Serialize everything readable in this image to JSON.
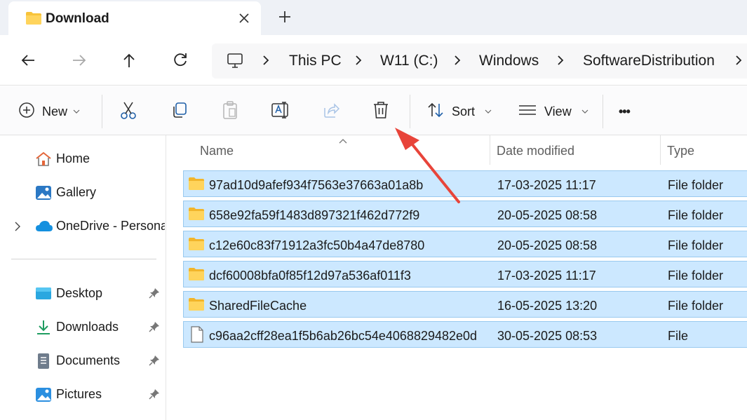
{
  "window": {
    "tab_title": "Download",
    "new_tab_symbol": "+"
  },
  "breadcrumb": [
    {
      "label": "This PC"
    },
    {
      "label": "W11 (C:)"
    },
    {
      "label": "Windows"
    },
    {
      "label": "SoftwareDistribution"
    }
  ],
  "toolbar": {
    "new_label": "New",
    "sort_label": "Sort",
    "view_label": "View",
    "more_symbol": "•••"
  },
  "sidebar": {
    "items": [
      {
        "label": "Home",
        "icon": "home-icon"
      },
      {
        "label": "Gallery",
        "icon": "gallery-icon"
      },
      {
        "label": "OneDrive - Persona",
        "icon": "onedrive-icon"
      },
      {
        "label": "Desktop",
        "icon": "desktop-icon"
      },
      {
        "label": "Downloads",
        "icon": "downloads-icon"
      },
      {
        "label": "Documents",
        "icon": "documents-icon"
      },
      {
        "label": "Pictures",
        "icon": "pictures-icon"
      }
    ]
  },
  "columns": {
    "name": "Name",
    "date": "Date modified",
    "type": "Type"
  },
  "files": [
    {
      "name": "97ad10d9afef934f7563e37663a01a8b",
      "date": "17-03-2025 11:17",
      "type": "File folder",
      "kind": "folder"
    },
    {
      "name": "658e92fa59f1483d897321f462d772f9",
      "date": "20-05-2025 08:58",
      "type": "File folder",
      "kind": "folder"
    },
    {
      "name": "c12e60c83f71912a3fc50b4a47de8780",
      "date": "20-05-2025 08:58",
      "type": "File folder",
      "kind": "folder"
    },
    {
      "name": "dcf60008bfa0f85f12d97a536af011f3",
      "date": "17-03-2025 11:17",
      "type": "File folder",
      "kind": "folder"
    },
    {
      "name": "SharedFileCache",
      "date": "16-05-2025 13:20",
      "type": "File folder",
      "kind": "folder"
    },
    {
      "name": "c96aa2cff28ea1f5b6ab26bc54e4068829482e0d",
      "date": "30-05-2025 08:53",
      "type": "File",
      "kind": "file"
    }
  ],
  "colors": {
    "selection_fill": "#cce8ff",
    "selection_border": "#99c9ef",
    "folder_yellow": "#f8c33a",
    "annotation_arrow": "#e8443a"
  }
}
